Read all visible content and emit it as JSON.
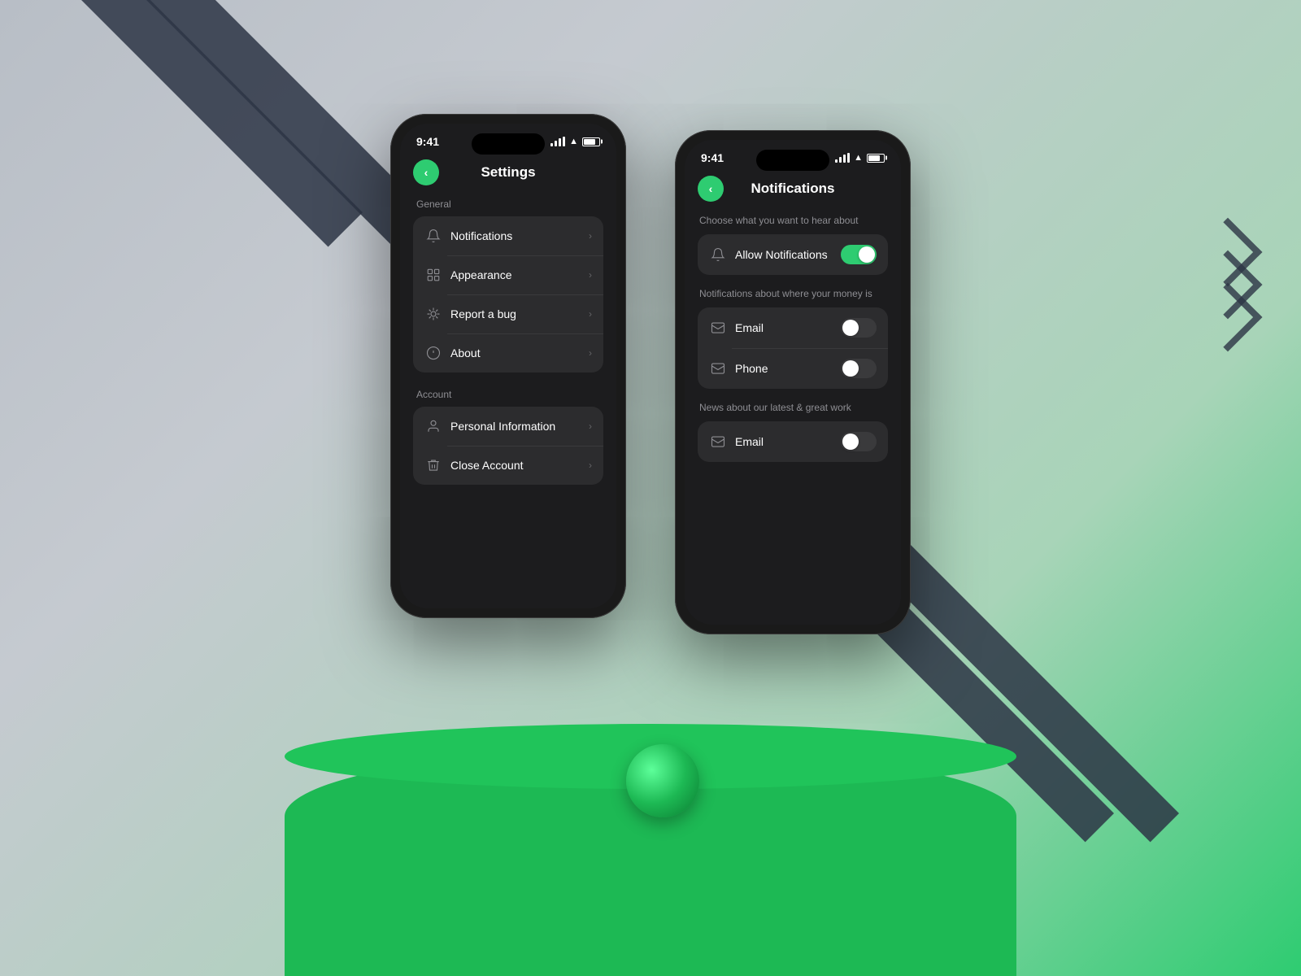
{
  "background": {
    "color_top": "#b8bec6",
    "color_bottom": "#1db954"
  },
  "phone1": {
    "title": "Settings",
    "status_time": "9:41",
    "back_label": "<",
    "general_section": {
      "label": "General",
      "items": [
        {
          "id": "notifications",
          "label": "Notifications",
          "icon": "bell-icon"
        },
        {
          "id": "appearance",
          "label": "Appearance",
          "icon": "grid-icon"
        },
        {
          "id": "report-bug",
          "label": "Report a bug",
          "icon": "bug-icon"
        },
        {
          "id": "about",
          "label": "About",
          "icon": "info-icon"
        }
      ]
    },
    "account_section": {
      "label": "Account",
      "items": [
        {
          "id": "personal-info",
          "label": "Personal Information",
          "icon": "person-icon"
        },
        {
          "id": "close-account",
          "label": "Close Account",
          "icon": "trash-icon"
        }
      ]
    }
  },
  "phone2": {
    "title": "Notifications",
    "status_time": "9:41",
    "back_label": "<",
    "subtitle_1": "Choose what you want to hear about",
    "allow_notifications_label": "Allow Notifications",
    "allow_notifications_on": true,
    "subtitle_2": "Notifications about where your money is",
    "money_items": [
      {
        "id": "email-money",
        "label": "Email",
        "enabled": false
      },
      {
        "id": "phone-money",
        "label": "Phone",
        "enabled": false
      }
    ],
    "subtitle_3": "News about our latest & great work",
    "news_items": [
      {
        "id": "email-news",
        "label": "Email",
        "enabled": false
      }
    ]
  }
}
